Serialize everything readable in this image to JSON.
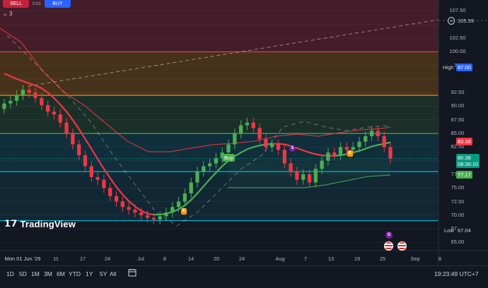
{
  "toolbar_top": {
    "sell_label": "SELL",
    "buy_label": "BUY",
    "spread": "0.01",
    "collapse_label": "3"
  },
  "brand": {
    "logo_text": "TradingView"
  },
  "y_axis": {
    "ticks": [
      "107.50",
      "102.50",
      "100.00",
      "97.50",
      "92.50",
      "90.00",
      "87.50",
      "85.00",
      "82.50",
      "77.50",
      "75.00",
      "72.50",
      "70.00",
      "67.50",
      "65.00"
    ]
  },
  "x_axis": {
    "ticks": [
      "Mon 01 Jun '26",
      "11",
      "17",
      "24",
      "Jul",
      "8",
      "14",
      "20",
      "24",
      "Aug",
      "7",
      "13",
      "19",
      "25",
      "Sep",
      "8"
    ]
  },
  "price_badges": {
    "crosshair": "105.59",
    "high_label": "High",
    "high_value": "97.00",
    "upper": "83.38",
    "last": "80.38",
    "countdown": "08:36:10",
    "lower": "77.17",
    "low_label": "Low",
    "low_value": "67.04"
  },
  "markers": {
    "buy_label": "Buy",
    "earnings_label": "E",
    "split_label": "S"
  },
  "bottom_toolbar": {
    "timeframes": [
      "1D",
      "5D",
      "1M",
      "3M",
      "6M",
      "YTD",
      "1Y",
      "5Y",
      "All"
    ],
    "clock": "19:23:49 UTC+7"
  },
  "colors": {
    "background": "#131722",
    "bull": "#4caf50",
    "bear": "#f23645",
    "zone_red": "#f23645",
    "zone_orange": "#ff9800",
    "zone_green": "#4caf50",
    "zone_teal": "#00bcd4"
  },
  "chart_data": {
    "type": "candlestick",
    "ylim": [
      63.5,
      109.5
    ],
    "x": [
      "06-01",
      "06-02",
      "06-03",
      "06-04",
      "06-05",
      "06-08",
      "06-09",
      "06-10",
      "06-11",
      "06-12",
      "06-15",
      "06-16",
      "06-17",
      "06-18",
      "06-19",
      "06-22",
      "06-23",
      "06-24",
      "06-25",
      "06-26",
      "06-29",
      "06-30",
      "07-01",
      "07-02",
      "07-03",
      "07-06",
      "07-07",
      "07-08",
      "07-09",
      "07-10",
      "07-13",
      "07-14",
      "07-15",
      "07-16",
      "07-17",
      "07-20",
      "07-21",
      "07-22",
      "07-23",
      "07-24",
      "07-27",
      "07-28",
      "07-29",
      "07-30",
      "07-31",
      "08-03",
      "08-04",
      "08-05",
      "08-06",
      "08-07",
      "08-10",
      "08-11",
      "08-12",
      "08-13",
      "08-14",
      "08-17",
      "08-18",
      "08-19",
      "08-20",
      "08-21",
      "08-24",
      "08-25",
      "08-26"
    ],
    "close": [
      90.5,
      91.0,
      92.0,
      93.0,
      92.5,
      91.5,
      90.2,
      89.0,
      88.5,
      87.0,
      85.0,
      83.0,
      81.0,
      79.0,
      77.0,
      76.5,
      75.0,
      73.5,
      72.5,
      71.5,
      71.0,
      70.5,
      70.0,
      69.5,
      69.2,
      69.8,
      70.5,
      71.5,
      72.5,
      74.0,
      76.0,
      78.0,
      79.0,
      79.5,
      80.5,
      81.5,
      83.0,
      85.0,
      86.5,
      87.0,
      86.0,
      84.0,
      82.5,
      83.0,
      82.0,
      79.5,
      78.0,
      76.5,
      77.5,
      76.0,
      78.5,
      80.0,
      81.5,
      81.0,
      82.5,
      82.0,
      82.5,
      83.5,
      84.5,
      85.5,
      84.5,
      82.5,
      80.38
    ],
    "open": [
      89.5,
      90.5,
      91.0,
      92.0,
      93.0,
      92.5,
      91.5,
      90.2,
      89.0,
      88.5,
      87.0,
      85.0,
      83.0,
      81.0,
      79.0,
      77.0,
      76.5,
      75.0,
      73.5,
      72.5,
      71.5,
      71.0,
      70.5,
      70.0,
      69.5,
      69.2,
      69.8,
      70.5,
      71.5,
      72.5,
      74.0,
      76.0,
      78.0,
      79.0,
      79.5,
      80.5,
      81.5,
      83.0,
      85.0,
      86.5,
      87.0,
      86.0,
      84.0,
      82.5,
      83.0,
      82.0,
      79.5,
      78.0,
      76.5,
      77.5,
      76.0,
      78.5,
      80.0,
      81.5,
      81.0,
      82.5,
      82.0,
      82.5,
      83.5,
      84.5,
      85.5,
      84.5,
      82.5
    ],
    "trailing_line": [
      96.0,
      95.5,
      95.0,
      94.6,
      94.2,
      93.8,
      93.3,
      92.5,
      91.5,
      90.3,
      89.0,
      87.5,
      85.8,
      84.0,
      82.2,
      80.3,
      78.5,
      76.8,
      75.2,
      73.8,
      72.6,
      71.6,
      70.8,
      70.3,
      70.1,
      70.1,
      70.3,
      70.6,
      71.1,
      71.8,
      72.8,
      74.0,
      75.3,
      76.6,
      77.8,
      79.0,
      80.0,
      80.8,
      81.5,
      82.1,
      82.5,
      82.8,
      83.0,
      83.1,
      83.1,
      83.0,
      82.7,
      82.3,
      81.9,
      81.5,
      81.2,
      81.0,
      80.9,
      80.9,
      81.0,
      81.2,
      81.5,
      81.8,
      82.2,
      82.6,
      82.9,
      83.1,
      83.38
    ],
    "zones": [
      100.0,
      92.0,
      85.0,
      78.0,
      69.0
    ],
    "high": 97.0,
    "low": 67.04,
    "last": 80.38
  }
}
